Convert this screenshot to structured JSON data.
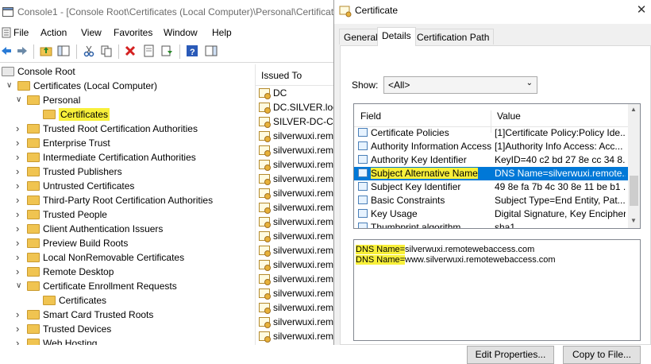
{
  "mmc": {
    "title": "Console1 - [Console Root\\Certificates (Local Computer)\\Personal\\Certificat",
    "menu": [
      "File",
      "Action",
      "View",
      "Favorites",
      "Window",
      "Help"
    ],
    "tree": [
      {
        "label": "Console Root",
        "indent": 0,
        "expanded": true
      },
      {
        "label": "Certificates (Local Computer)",
        "indent": 1,
        "expanded": true
      },
      {
        "label": "Personal",
        "indent": 2,
        "expanded": true
      },
      {
        "label": "Certificates",
        "indent": 3,
        "selected": true
      },
      {
        "label": "Trusted Root Certification Authorities",
        "indent": 2
      },
      {
        "label": "Enterprise Trust",
        "indent": 2
      },
      {
        "label": "Intermediate Certification Authorities",
        "indent": 2
      },
      {
        "label": "Trusted Publishers",
        "indent": 2
      },
      {
        "label": "Untrusted Certificates",
        "indent": 2
      },
      {
        "label": "Third-Party Root Certification Authorities",
        "indent": 2
      },
      {
        "label": "Trusted People",
        "indent": 2
      },
      {
        "label": "Client Authentication Issuers",
        "indent": 2
      },
      {
        "label": "Preview Build Roots",
        "indent": 2
      },
      {
        "label": "Local NonRemovable Certificates",
        "indent": 2
      },
      {
        "label": "Remote Desktop",
        "indent": 2
      },
      {
        "label": "Certificate Enrollment Requests",
        "indent": 2,
        "expanded": true
      },
      {
        "label": "Certificates",
        "indent": 3
      },
      {
        "label": "Smart Card Trusted Roots",
        "indent": 2
      },
      {
        "label": "Trusted Devices",
        "indent": 2
      },
      {
        "label": "Web Hosting",
        "indent": 2
      }
    ],
    "list_header": "Issued To",
    "list_items": [
      "DC",
      "DC.SILVER.loc",
      "SILVER-DC-CA",
      "silverwuxi.rem",
      "silverwuxi.rem",
      "silverwuxi.rem",
      "silverwuxi.rem",
      "silverwuxi.rem",
      "silverwuxi.rem",
      "silverwuxi.rem",
      "silverwuxi.rem",
      "silverwuxi.rem",
      "silverwuxi.rem",
      "silverwuxi.rem",
      "silverwuxi.rem",
      "silverwuxi.rem",
      "silverwuxi.rem",
      "silverwuxi.rem"
    ]
  },
  "dialog": {
    "title": "Certificate",
    "close": "✕",
    "tabs": [
      "General",
      "Details",
      "Certification Path"
    ],
    "active_tab": "Details",
    "show_label": "Show:",
    "show_value": "<All>",
    "columns": {
      "field": "Field",
      "value": "Value"
    },
    "fields": [
      {
        "field": "Certificate Policies",
        "value": "[1]Certificate Policy:Policy Ide..."
      },
      {
        "field": "Authority Information Access",
        "value": "[1]Authority Info Access: Acc..."
      },
      {
        "field": "Authority Key Identifier",
        "value": "KeyID=40 c2 bd 27 8e cc 34 8..."
      },
      {
        "field": "Subject Alternative Name",
        "value": "DNS Name=silverwuxi.remote...",
        "selected": true
      },
      {
        "field": "Subject Key Identifier",
        "value": "49 8e fa 7b 4c 30 8e 11 be b1 ..."
      },
      {
        "field": "Basic Constraints",
        "value": "Subject Type=End Entity, Pat..."
      },
      {
        "field": "Key Usage",
        "value": "Digital Signature, Key Encipher..."
      },
      {
        "field": "Thumbprint algorithm",
        "value": "sha1"
      }
    ],
    "detail_lines": [
      {
        "label": "DNS Name=",
        "value": "silverwuxi.remotewebaccess.com"
      },
      {
        "label": "DNS Name=",
        "value": "www.silverwuxi.remotewebaccess.com"
      }
    ],
    "buttons": {
      "edit": "Edit Properties...",
      "copy": "Copy to File..."
    }
  },
  "colors": {
    "selection": "#0078d7",
    "highlight": "#f8f03a"
  }
}
